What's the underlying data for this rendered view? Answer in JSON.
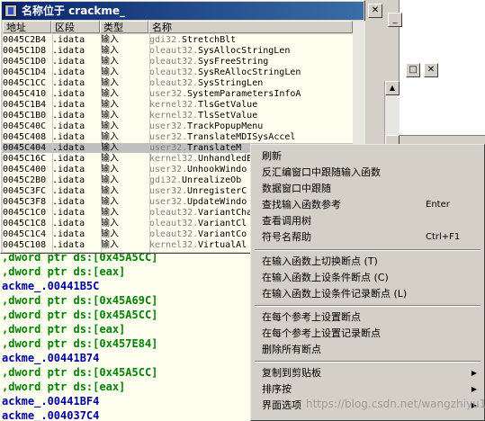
{
  "window": {
    "title": "名称位于 crackme_",
    "columns": [
      "地址",
      "区段",
      "类型",
      "名称"
    ]
  },
  "names": [
    {
      "addr": "0045C2B4",
      "section": ".idata",
      "type": "输入",
      "lib": "gdi32.",
      "sym": "StretchBlt"
    },
    {
      "addr": "0045C1D8",
      "section": ".idata",
      "type": "输入",
      "lib": "oleaut32.",
      "sym": "SysAllocStringLen"
    },
    {
      "addr": "0045C1D0",
      "section": ".idata",
      "type": "输入",
      "lib": "oleaut32.",
      "sym": "SysFreeString"
    },
    {
      "addr": "0045C1D4",
      "section": ".idata",
      "type": "输入",
      "lib": "oleaut32.",
      "sym": "SysReAllocStringLen"
    },
    {
      "addr": "0045C1CC",
      "section": ".idata",
      "type": "输入",
      "lib": "oleaut32.",
      "sym": "SysStringLen"
    },
    {
      "addr": "0045C410",
      "section": ".idata",
      "type": "输入",
      "lib": "user32.",
      "sym": "SystemParametersInfoA"
    },
    {
      "addr": "0045C1B4",
      "section": ".idata",
      "type": "输入",
      "lib": "kernel32.",
      "sym": "TlsGetValue"
    },
    {
      "addr": "0045C1B0",
      "section": ".idata",
      "type": "输入",
      "lib": "kernel32.",
      "sym": "TlsSetValue"
    },
    {
      "addr": "0045C40C",
      "section": ".idata",
      "type": "输入",
      "lib": "user32.",
      "sym": "TrackPopupMenu"
    },
    {
      "addr": "0045C408",
      "section": ".idata",
      "type": "输入",
      "lib": "user32.",
      "sym": "TranslateMDISysAccel"
    },
    {
      "addr": "0045C404",
      "section": ".idata",
      "type": "输入",
      "lib": "user32.",
      "sym": "TranslateM"
    },
    {
      "addr": "0045C16C",
      "section": ".idata",
      "type": "输入",
      "lib": "kernel32.",
      "sym": "UnhandledE"
    },
    {
      "addr": "0045C400",
      "section": ".idata",
      "type": "输入",
      "lib": "user32.",
      "sym": "UnhookWindo"
    },
    {
      "addr": "0045C2B0",
      "section": ".idata",
      "type": "输入",
      "lib": "gdi32.",
      "sym": "UnrealizeOb"
    },
    {
      "addr": "0045C3FC",
      "section": ".idata",
      "type": "输入",
      "lib": "user32.",
      "sym": "UnregisterC"
    },
    {
      "addr": "0045C3F8",
      "section": ".idata",
      "type": "输入",
      "lib": "user32.",
      "sym": "UpdateWindo"
    },
    {
      "addr": "0045C1C0",
      "section": ".idata",
      "type": "输入",
      "lib": "oleaut32.",
      "sym": "VariantCha"
    },
    {
      "addr": "0045C1C8",
      "section": ".idata",
      "type": "输入",
      "lib": "oleaut32.",
      "sym": "VariantCl"
    },
    {
      "addr": "0045C1C4",
      "section": ".idata",
      "type": "输入",
      "lib": "oleaut32.",
      "sym": "VariantCo"
    },
    {
      "addr": "0045C108",
      "section": ".idata",
      "type": "输入",
      "lib": "kernel32.",
      "sym": "VirtualAl"
    }
  ],
  "selected_row": 10,
  "disasm": [
    {
      "text": ",dword ptr ds:[0x45A5CC]",
      "color": "green"
    },
    {
      "text": ",dword ptr ds:[eax]",
      "color": "green"
    },
    {
      "text": "ackme_.00441B5C",
      "color": "blue"
    },
    {
      "text": ",dword ptr ds:[0x45A69C]",
      "color": "green"
    },
    {
      "text": ",dword ptr ds:[0x45A5CC]",
      "color": "green"
    },
    {
      "text": ",dword ptr ds:[eax]",
      "color": "green"
    },
    {
      "text": ",dword ptr ds:[0x457E84]",
      "color": "green"
    },
    {
      "text": "ackme_.00441B74",
      "color": "blue"
    },
    {
      "text": ",dword ptr ds:[0x45A5CC]",
      "color": "green"
    },
    {
      "text": ",dword ptr ds:[eax]",
      "color": "green"
    },
    {
      "text": "ackme_.00441BF4",
      "color": "blue"
    },
    {
      "text": "ackme_.004037C4",
      "color": "blue"
    }
  ],
  "context_menu": {
    "items": [
      {
        "label": "刷新",
        "shortcut": ""
      },
      {
        "label": "反汇编窗口中跟随输入函数",
        "shortcut": ""
      },
      {
        "label": "数据窗口中跟随",
        "shortcut": ""
      },
      {
        "label": "查找输入函数参考",
        "shortcut": "Enter"
      },
      {
        "label": "查看调用树",
        "shortcut": ""
      },
      {
        "label": "符号名帮助",
        "shortcut": "Ctrl+F1"
      },
      {
        "label": "在输入函数上切换断点 (T)",
        "shortcut": ""
      },
      {
        "label": "在输入函数上设条件断点 (C)",
        "shortcut": ""
      },
      {
        "label": "在输入函数上设条件记录断点 (L)",
        "shortcut": ""
      },
      {
        "label": "在每个参考上设置断点",
        "shortcut": ""
      },
      {
        "label": "在每个参考上设置记录断点",
        "shortcut": ""
      },
      {
        "label": "删除所有断点",
        "shortcut": ""
      },
      {
        "label": "复制到剪贴板",
        "shortcut": ""
      },
      {
        "label": "排序按",
        "shortcut": ""
      },
      {
        "label": "界面选项",
        "shortcut": ""
      }
    ]
  },
  "watermark": "https://blog.csdn.net/wangzhiyu13",
  "colors": {
    "title_bar": "#0a246a",
    "list_bg": "#fffff0",
    "selected_row": "#c0c0c0",
    "disasm_green": "#008000",
    "disasm_blue": "#0000a0"
  }
}
